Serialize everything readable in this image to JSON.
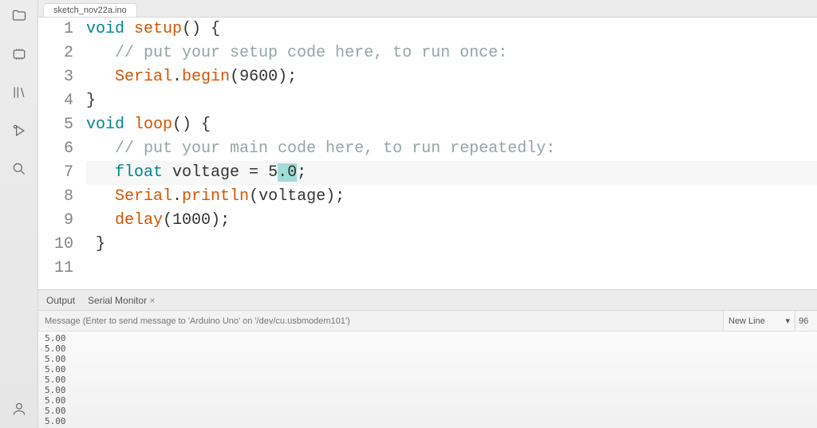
{
  "tab": {
    "filename": "sketch_nov22a.ino"
  },
  "code": {
    "lines": [
      {
        "n": 1,
        "tokens": [
          [
            "kw",
            "void"
          ],
          [
            "sp",
            " "
          ],
          [
            "func",
            "setup"
          ],
          [
            "plain",
            "() {"
          ]
        ]
      },
      {
        "n": 2,
        "tokens": [
          [
            "plain",
            "   "
          ],
          [
            "comment",
            "// put your setup code here, to run once:"
          ]
        ]
      },
      {
        "n": 3,
        "tokens": [
          [
            "plain",
            "   "
          ],
          [
            "func",
            "Serial"
          ],
          [
            "plain",
            "."
          ],
          [
            "func",
            "begin"
          ],
          [
            "plain",
            "("
          ],
          [
            "num",
            "9600"
          ],
          [
            "plain",
            ");"
          ]
        ]
      },
      {
        "n": 4,
        "tokens": [
          [
            "plain",
            "}"
          ]
        ]
      },
      {
        "n": 5,
        "tokens": [
          [
            "plain",
            ""
          ]
        ]
      },
      {
        "n": 6,
        "tokens": [
          [
            "kw",
            "void"
          ],
          [
            "sp",
            " "
          ],
          [
            "func",
            "loop"
          ],
          [
            "plain",
            "() {"
          ]
        ]
      },
      {
        "n": 7,
        "tokens": [
          [
            "plain",
            "   "
          ],
          [
            "comment",
            "// put your main code here, to run repeatedly:"
          ]
        ]
      },
      {
        "n": 8,
        "cursor": true,
        "tokens": [
          [
            "plain",
            "   "
          ],
          [
            "type",
            "float"
          ],
          [
            "plain",
            " voltage = "
          ],
          [
            "num",
            "5"
          ],
          [
            "sel",
            ".0"
          ],
          [
            "plain",
            ";"
          ]
        ]
      },
      {
        "n": 9,
        "tokens": [
          [
            "plain",
            "   "
          ],
          [
            "func",
            "Serial"
          ],
          [
            "plain",
            "."
          ],
          [
            "func",
            "println"
          ],
          [
            "plain",
            "(voltage);"
          ]
        ]
      },
      {
        "n": 10,
        "tokens": [
          [
            "plain",
            "   "
          ],
          [
            "func",
            "delay"
          ],
          [
            "plain",
            "("
          ],
          [
            "num",
            "1000"
          ],
          [
            "plain",
            ");"
          ]
        ]
      },
      {
        "n": 11,
        "tokens": [
          [
            "plain",
            " }"
          ]
        ]
      }
    ]
  },
  "bottom": {
    "output_tab": "Output",
    "serial_tab": "Serial Monitor",
    "msg_placeholder": "Message (Enter to send message to 'Arduino Uno' on '/dev/cu.usbmodem101')",
    "line_ending": "New Line",
    "baud_partial": "96"
  },
  "serial": {
    "lines": [
      "5.00",
      "5.00",
      "5.00",
      "5.00",
      "5.00",
      "5.00",
      "5.00",
      "5.00",
      "5.00"
    ]
  }
}
